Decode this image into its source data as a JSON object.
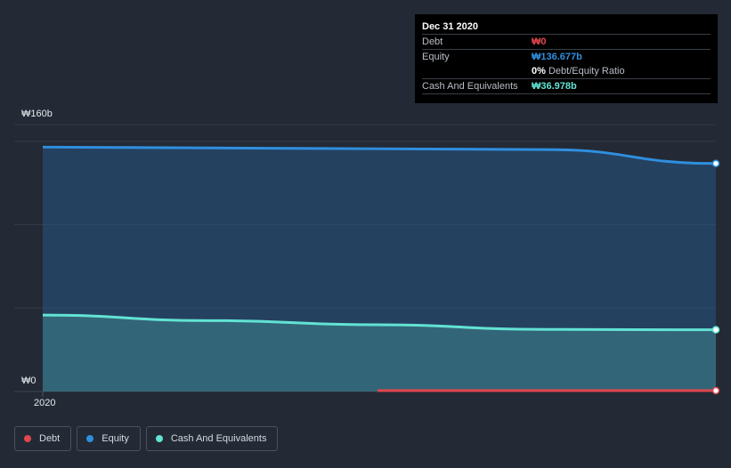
{
  "tooltip": {
    "date": "Dec 31 2020",
    "debt_label": "Debt",
    "debt_value": "₩0",
    "equity_label": "Equity",
    "equity_value": "₩136.677b",
    "ratio_value": "0%",
    "ratio_label": "Debt/Equity Ratio",
    "cash_label": "Cash And Equivalents",
    "cash_value": "₩36.978b"
  },
  "legend": [
    {
      "label": "Debt",
      "color": "#e0464e"
    },
    {
      "label": "Equity",
      "color": "#2f8fdf"
    },
    {
      "label": "Cash And Equivalents",
      "color": "#62e3d3"
    }
  ],
  "colors": {
    "background": "#232a35",
    "debt": "#e0464e",
    "equity": "#2f8fdf",
    "cash": "#62e3d3"
  },
  "chart_data": {
    "type": "area",
    "title": "",
    "xlabel": "",
    "ylabel": "",
    "y_tick_labels": [
      "₩160b",
      "₩0"
    ],
    "x_tick_labels": [
      "2020"
    ],
    "ylim": [
      0,
      160
    ],
    "x": [
      "2020-01-01",
      "2020-03-31",
      "2020-06-30",
      "2020-09-30",
      "2020-12-31"
    ],
    "series": [
      {
        "name": "Debt",
        "values": [
          null,
          null,
          0,
          0,
          0
        ]
      },
      {
        "name": "Equity",
        "values": [
          146.5,
          146.0,
          145.5,
          145.0,
          136.677
        ]
      },
      {
        "name": "Cash And Equivalents",
        "values": [
          45.8,
          42.5,
          40.0,
          37.2,
          36.978
        ]
      }
    ],
    "grid": true,
    "legend_position": "bottom-left"
  }
}
